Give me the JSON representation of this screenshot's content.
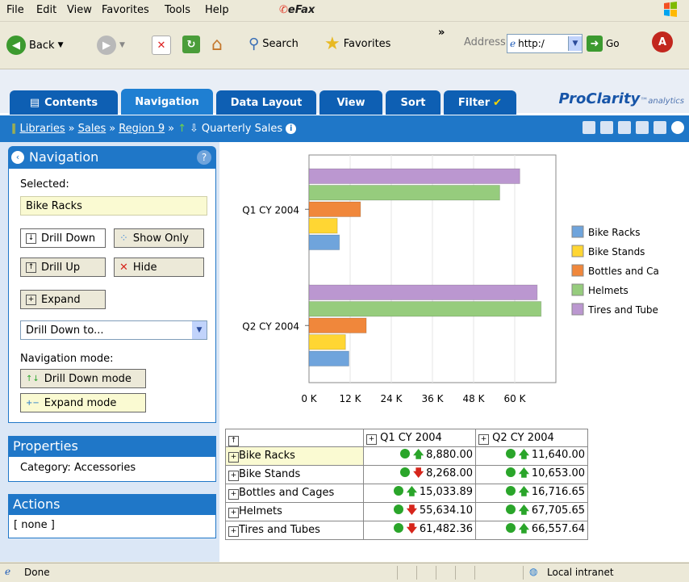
{
  "menu": {
    "items": [
      "File",
      "Edit",
      "View",
      "Favorites",
      "Tools",
      "Help"
    ],
    "efax": "eFax"
  },
  "toolbar": {
    "back": "Back",
    "search": "Search",
    "favorites": "Favorites",
    "address_label": "Address",
    "address_value": "http:/",
    "go": "Go"
  },
  "tabs": [
    {
      "label": "Contents"
    },
    {
      "label": "Navigation"
    },
    {
      "label": "Data Layout"
    },
    {
      "label": "View"
    },
    {
      "label": "Sort"
    },
    {
      "label": "Filter"
    }
  ],
  "brand": {
    "name": "ProClarity",
    "sub": "analytics"
  },
  "breadcrumb": {
    "items": [
      "Libraries",
      "Sales",
      "Region 9"
    ],
    "current": "Quarterly Sales"
  },
  "navigation": {
    "title": "Navigation",
    "selected_label": "Selected:",
    "selected_value": "Bike Racks",
    "drill_down": "Drill Down",
    "show_only": "Show Only",
    "drill_up": "Drill Up",
    "hide": "Hide",
    "expand": "Expand",
    "drill_to": "Drill Down to...",
    "mode_label": "Navigation mode:",
    "mode_drill": "Drill Down mode",
    "mode_expand": "Expand mode"
  },
  "properties": {
    "title": "Properties",
    "category": "Category: Accessories"
  },
  "actions": {
    "title": "Actions",
    "value": "[ none ]"
  },
  "chart_data": {
    "type": "bar",
    "orientation": "horizontal",
    "categories": [
      "Q1 CY 2004",
      "Q2 CY 2004"
    ],
    "series": [
      {
        "name": "Bike Racks",
        "values": [
          8880.0,
          11640.0
        ],
        "color": "#6fa4dc"
      },
      {
        "name": "Bike Stands",
        "values": [
          8268.0,
          10653.0
        ],
        "color": "#ffd633"
      },
      {
        "name": "Bottles and Ca",
        "values": [
          15033.89,
          16716.65
        ],
        "color": "#f0873b"
      },
      {
        "name": "Helmets",
        "values": [
          55634.1,
          67705.65
        ],
        "color": "#96cc7d"
      },
      {
        "name": "Tires and Tube",
        "values": [
          61482.36,
          66557.64
        ],
        "color": "#bb97d0"
      }
    ],
    "xticks": [
      "0 K",
      "12 K",
      "24 K",
      "36 K",
      "48 K",
      "60 K"
    ],
    "xlim": [
      0,
      72000
    ],
    "grid": true,
    "legend": "right"
  },
  "pivot": {
    "columns": [
      "Q1 CY 2004",
      "Q2 CY 2004"
    ],
    "rows": [
      {
        "label": "Bike Racks",
        "q1": "8,880.00",
        "q1_trend": "up",
        "q2": "11,640.00",
        "q2_trend": "up"
      },
      {
        "label": "Bike Stands",
        "q1": "8,268.00",
        "q1_trend": "down",
        "q2": "10,653.00",
        "q2_trend": "up"
      },
      {
        "label": "Bottles and Cages",
        "q1": "15,033.89",
        "q1_trend": "up",
        "q2": "16,716.65",
        "q2_trend": "up"
      },
      {
        "label": "Helmets",
        "q1": "55,634.10",
        "q1_trend": "down",
        "q2": "67,705.65",
        "q2_trend": "up"
      },
      {
        "label": "Tires and Tubes",
        "q1": "61,482.36",
        "q1_trend": "down",
        "q2": "66,557.64",
        "q2_trend": "up"
      }
    ]
  },
  "status": {
    "text": "Done",
    "zone": "Local intranet"
  }
}
